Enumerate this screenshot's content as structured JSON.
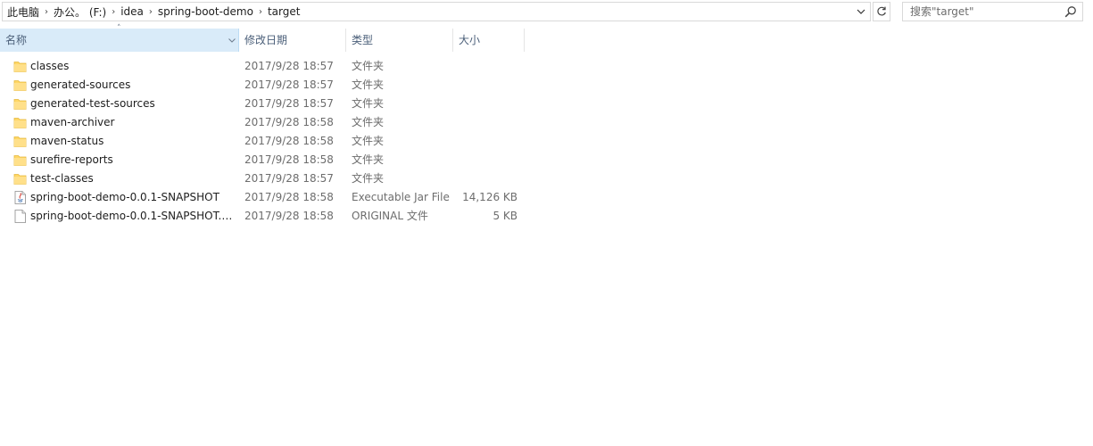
{
  "address_bar": {
    "crumbs": [
      "此电脑",
      "办公。 (F:)",
      "idea",
      "spring-boot-demo",
      "target"
    ]
  },
  "search": {
    "placeholder": "搜索\"target\""
  },
  "columns": {
    "name": "名称",
    "date": "修改日期",
    "type": "类型",
    "size": "大小"
  },
  "files": [
    {
      "name": "classes",
      "date": "2017/9/28 18:57",
      "type": "文件夹",
      "size": "",
      "icon": "folder-icon"
    },
    {
      "name": "generated-sources",
      "date": "2017/9/28 18:57",
      "type": "文件夹",
      "size": "",
      "icon": "folder-icon"
    },
    {
      "name": "generated-test-sources",
      "date": "2017/9/28 18:57",
      "type": "文件夹",
      "size": "",
      "icon": "folder-icon"
    },
    {
      "name": "maven-archiver",
      "date": "2017/9/28 18:58",
      "type": "文件夹",
      "size": "",
      "icon": "folder-icon"
    },
    {
      "name": "maven-status",
      "date": "2017/9/28 18:58",
      "type": "文件夹",
      "size": "",
      "icon": "folder-icon"
    },
    {
      "name": "surefire-reports",
      "date": "2017/9/28 18:58",
      "type": "文件夹",
      "size": "",
      "icon": "folder-icon"
    },
    {
      "name": "test-classes",
      "date": "2017/9/28 18:57",
      "type": "文件夹",
      "size": "",
      "icon": "folder-icon"
    },
    {
      "name": "spring-boot-demo-0.0.1-SNAPSHOT",
      "date": "2017/9/28 18:58",
      "type": "Executable Jar File",
      "size": "14,126 KB",
      "icon": "java-jar-icon"
    },
    {
      "name": "spring-boot-demo-0.0.1-SNAPSHOT.j...",
      "date": "2017/9/28 18:58",
      "type": "ORIGINAL 文件",
      "size": "5 KB",
      "icon": "file-icon"
    }
  ],
  "colors": {
    "sorted_header_bg": "#d9ebf9",
    "header_text": "#4c607a",
    "folder_yellow": "#ffd766",
    "secondary_text": "#6d6d6d"
  }
}
